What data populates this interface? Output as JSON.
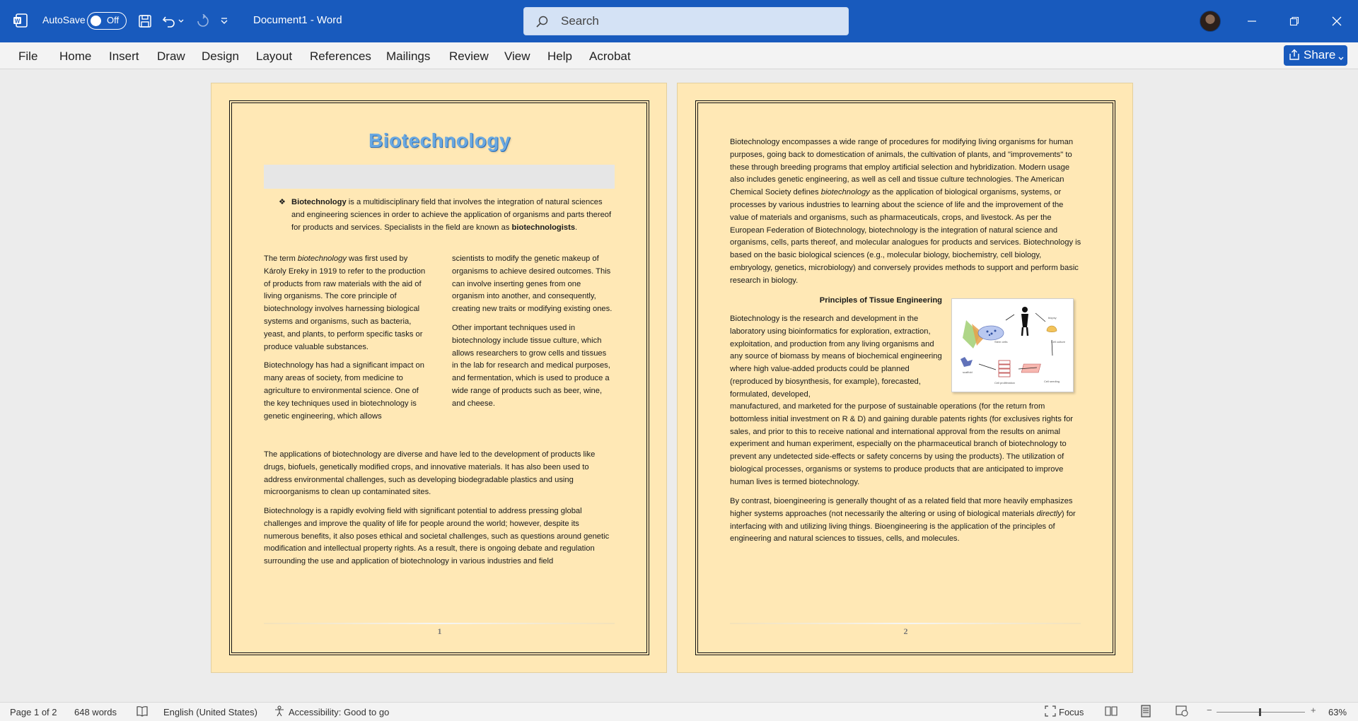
{
  "titlebar": {
    "autosave_label": "AutoSave",
    "autosave_state": "Off",
    "doc_title": "Document1  -  Word",
    "search_placeholder": "Search"
  },
  "ribbon": {
    "tabs": [
      "File",
      "Home",
      "Insert",
      "Draw",
      "Design",
      "Layout",
      "References",
      "Mailings",
      "Review",
      "View",
      "Help",
      "Acrobat"
    ],
    "share_label": "Share"
  },
  "page1": {
    "title": "Biotechnology",
    "bullet_bold1": "Biotechnology",
    "bullet_text1": " is a multidisciplinary field that involves the integration of natural sciences and engineering sciences in order to achieve the application of organisms and parts thereof for products and services.  Specialists in the field are known as ",
    "bullet_bold2": "biotechnologists",
    "bullet_end": ".",
    "left_p1_a": "The term ",
    "left_p1_italic": "biotechnology",
    "left_p1_b": " was first used by Károly Ereky in 1919 to refer to the production of products from raw materials with the aid of living organisms. The core principle of biotechnology involves harnessing biological systems and organisms, such as bacteria, yeast, and plants, to perform specific tasks or produce valuable substances.",
    "left_p2": "Biotechnology has had a significant impact on many areas of society, from medicine to agriculture to environmental science. One of the key techniques used in biotechnology is genetic engineering, which allows",
    "right_p1": "scientists to modify the genetic makeup of organisms to achieve desired outcomes. This can involve inserting genes from one organism into another, and consequently, creating new traits or modifying existing ones.",
    "right_p2": "Other important techniques used in biotechnology include tissue culture, which allows researchers to grow cells and tissues in the lab for research and medical purposes, and fermentation, which is used to produce a wide range of products such as beer, wine, and cheese.",
    "full_p1": "The applications of biotechnology are diverse and have led to the development of products like drugs, biofuels, genetically modified crops, and innovative materials. It has also been used to address environmental challenges, such as developing biodegradable plastics and using microorganisms to clean up contaminated sites.",
    "full_p2": "Biotechnology is a rapidly evolving field with significant potential to address pressing global challenges and improve the quality of life for people around the world; however, despite its numerous benefits, it also poses ethical and societal challenges, such as questions around genetic modification and intellectual property rights. As a result, there is ongoing debate and regulation surrounding the use and application of biotechnology in various industries and field",
    "page_number": "1"
  },
  "page2": {
    "p1_a": "Biotechnology encompasses a wide range of procedures for modifying living organisms for human purposes, going back to domestication of animals, the cultivation of plants, and \"improvements\" to these through breeding programs that employ artificial selection and hybridization. Modern usage also includes genetic engineering, as well as cell and tissue culture technologies. The American Chemical Society defines ",
    "p1_italic": "biotechnology",
    "p1_b": " as the application of biological organisms, systems, or processes by various industries to learning about the science of life and the improvement of the value of materials and organisms, such as pharmaceuticals, crops, and livestock. As per the European Federation of Biotechnology, biotechnology is the integration of natural science and organisms, cells, parts thereof, and molecular analogues for products and services. Biotechnology is based on the basic biological sciences (e.g., molecular biology, biochemistry, cell biology, embryology, genetics, microbiology) and conversely provides methods to support and perform basic research in biology.",
    "section_heading": "Principles of Tissue Engineering",
    "wrap_text": "Biotechnology is the research and development in the laboratory using bioinformatics for exploration, extraction, exploitation, and production from any living organisms and any source of biomass by means of biochemical engineering where high value-added products could be planned (reproduced by biosynthesis, for example), forecasted, formulated, developed,",
    "p2_cont": "manufactured, and marketed for the purpose of sustainable operations (for the return from bottomless initial investment on R & D) and gaining durable patents rights (for exclusives rights for sales, and prior to this to receive national and international approval from the results on animal experiment and human experiment, especially on the pharmaceutical branch of biotechnology to prevent any undetected side-effects or safety concerns by using the products). The utilization of biological processes, organisms or systems to produce products that are anticipated to improve human lives is termed biotechnology.",
    "p3_a": "By contrast, bioengineering is generally thought of as a related field that more heavily emphasizes higher systems approaches (not necessarily the altering or using of biological materials ",
    "p3_italic": "directly",
    "p3_b": ") for interfacing with and utilizing living things. Bioengineering is the application of the principles of engineering and natural sciences to tissues, cells, and molecules.",
    "page_number": "2"
  },
  "statusbar": {
    "page": "Page 1 of 2",
    "words": "648 words",
    "language": "English (United States)",
    "accessibility": "Accessibility: Good to go",
    "focus": "Focus",
    "zoom": "63%"
  },
  "colors": {
    "titlebar": "#185abd",
    "page_bg": "#ffe8b5",
    "title_text": "#6aa8e0"
  }
}
